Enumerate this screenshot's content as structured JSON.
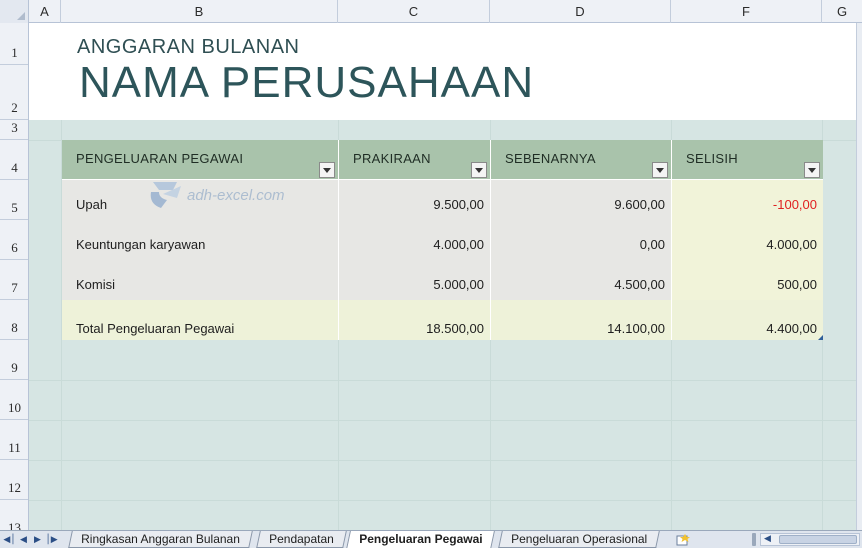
{
  "columns": [
    "A",
    "B",
    "C",
    "D",
    "F",
    "G"
  ],
  "rows": [
    "1",
    "2",
    "3",
    "4",
    "5",
    "6",
    "7",
    "8",
    "9",
    "10",
    "11",
    "12",
    "13"
  ],
  "header": {
    "subtitle": "ANGGARAN BULANAN",
    "title": "NAMA PERUSAHAAN"
  },
  "table": {
    "columns": [
      "PENGELUARAN PEGAWAI",
      "PRAKIRAAN",
      "SEBENARNYA",
      "SELISIH"
    ],
    "rows": [
      {
        "label": "Upah",
        "forecast": "9.500,00",
        "actual": "9.600,00",
        "diff": "-100,00"
      },
      {
        "label": "Keuntungan karyawan",
        "forecast": "4.000,00",
        "actual": "0,00",
        "diff": "4.000,00"
      },
      {
        "label": "Komisi",
        "forecast": "5.000,00",
        "actual": "4.500,00",
        "diff": "500,00"
      }
    ],
    "total": {
      "label": "Total Pengeluaran Pegawai",
      "forecast": "18.500,00",
      "actual": "14.100,00",
      "diff": "4.400,00"
    }
  },
  "watermark": "adh-excel.com",
  "sheet_tabs": [
    "Ringkasan Anggaran Bulanan",
    "Pendapatan",
    "Pengeluaran Pegawai",
    "Pengeluaran Operasional"
  ],
  "active_tab": "Pengeluaran Pegawai",
  "colors": {
    "header_fill": "#a9c3ab",
    "band": "#d6e5e3",
    "title": "#2d555a",
    "negative": "#e02020",
    "total_fill": "#eef2d9"
  }
}
